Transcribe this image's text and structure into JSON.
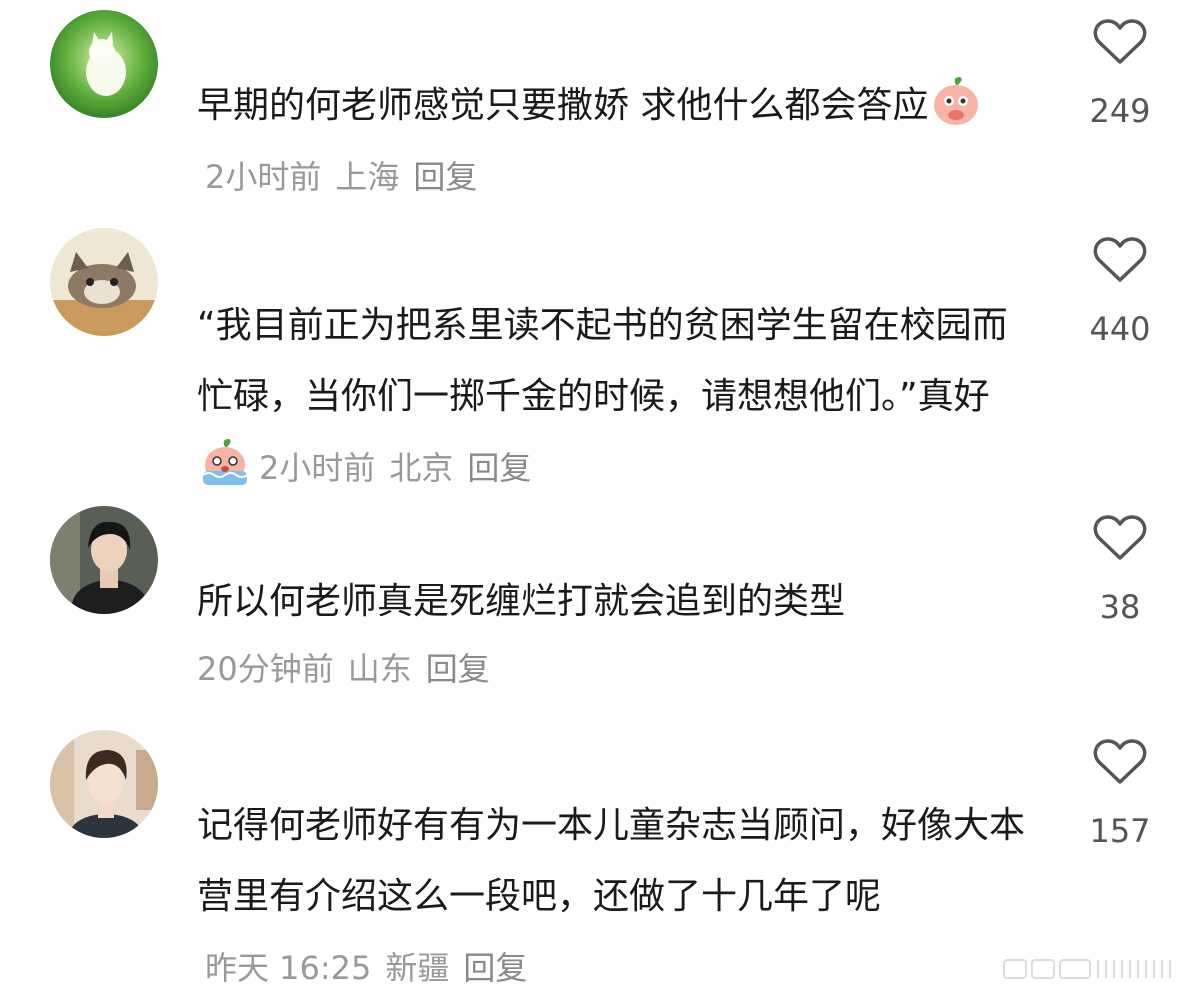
{
  "comments": [
    {
      "text": "早期的何老师感觉只要撒娇 求他什么都会答应",
      "emoji": "shy-blush-emoji",
      "time": "2小时前",
      "location": "上海",
      "reply": "回复",
      "likes": "249",
      "avatar": "white-cat-on-grass-avatar"
    },
    {
      "text": "“我目前正为把系里读不起书的贫困学生留在校园而忙碌，当你们一掷千金的时候，请想想他们。”真好",
      "emoji": "crying-emoji",
      "time": "2小时前",
      "location": "北京",
      "reply": "回复",
      "likes": "440",
      "avatar": "tabby-cat-avatar"
    },
    {
      "text": "所以何老师真是死缠烂打就会追到的类型",
      "time": "20分钟前",
      "location": "山东",
      "reply": "回复",
      "likes": "38",
      "avatar": "woman-portrait-avatar"
    },
    {
      "text": "记得何老师好有有为一本儿童杂志当顾问，好像大本营里有介绍这么一段吧，还做了十几年了呢",
      "time": "昨天 16:25",
      "location": "新疆",
      "reply": "回复",
      "likes": "157",
      "avatar": "young-man-portrait-avatar"
    }
  ],
  "colors": {
    "text": "#1a1a1a",
    "meta": "#999999",
    "like_icon": "#555555"
  }
}
